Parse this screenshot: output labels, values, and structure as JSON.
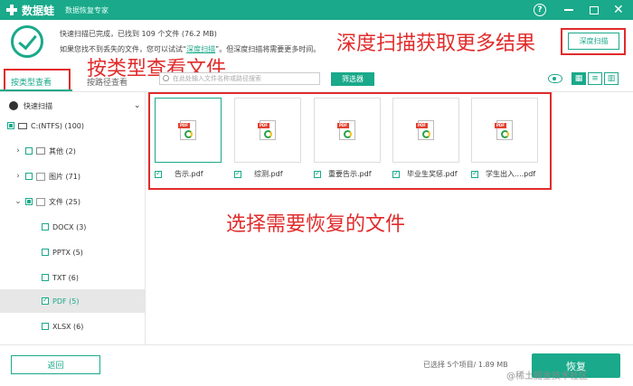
{
  "titlebar": {
    "app_name": "数据蛙",
    "subtitle": "数据恢复专家",
    "help_label": "?",
    "close_label": "✕"
  },
  "info": {
    "scan_status": "快速扫描已完成，已找到 109 个文件 (76.2 MB)",
    "hint_before": "如果您找不到丢失的文件，您可以试试“",
    "hint_link": "深度扫描",
    "hint_after": "”。但深度扫描将需要更多时间。",
    "deep_scan_button": "深度扫描"
  },
  "annotations": {
    "deep_scan": "深度扫描获取更多结果",
    "by_type": "按类型查看文件",
    "select_files": "选择需要恢复的文件",
    "color": "#e12b2b"
  },
  "tabs": {
    "by_type": "按类型查看",
    "by_path": "按路径查看"
  },
  "toolbar": {
    "search_placeholder": "在此处输入文件名称或路径搜索",
    "filter_button": "筛选器",
    "view_grid": "▦",
    "view_list": "≡",
    "view_detail": "▥"
  },
  "tree": {
    "quick_scan": "快速扫描",
    "quick_scan_caret": "⌄",
    "items": [
      {
        "label": "C:(NTFS) (100)"
      },
      {
        "label": "其他 (2)"
      },
      {
        "label": "图片 (71)"
      },
      {
        "label": "文件 (25)"
      },
      {
        "label": "DOCX (3)"
      },
      {
        "label": "PPTX (5)"
      },
      {
        "label": "TXT (6)"
      },
      {
        "label": "PDF (5)"
      },
      {
        "label": "XLSX (6)"
      }
    ]
  },
  "files": [
    {
      "name": "告示.pdf"
    },
    {
      "name": "综测.pdf"
    },
    {
      "name": "重要告示.pdf"
    },
    {
      "name": "毕业生奖惩.pdf"
    },
    {
      "name": "学生出入....pdf"
    }
  ],
  "pdf_tag": "PDF",
  "footer": {
    "back_button": "返回",
    "summary": "已选择 5个项目/ 1.89 MB",
    "recover_button": "恢复",
    "watermark": "@稀土掘金技术社区"
  },
  "colors": {
    "brand": "#1aa98a",
    "annotation": "#e12b2b"
  }
}
